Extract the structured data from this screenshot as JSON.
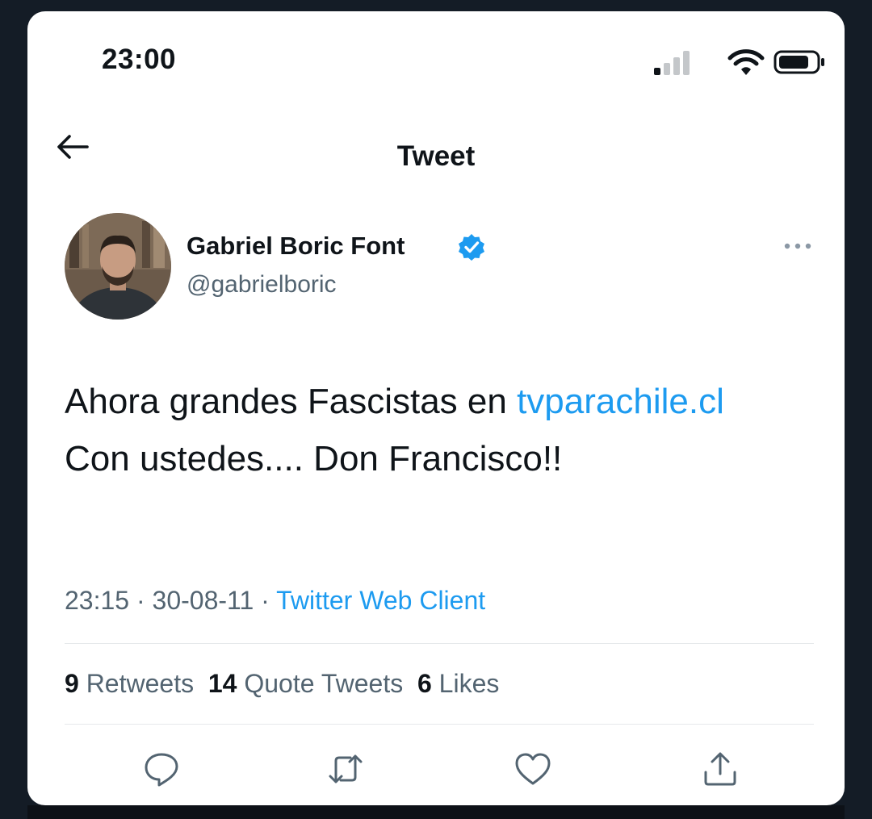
{
  "status_bar": {
    "time": "23:00",
    "signal_icon": "cellular-signal-icon",
    "wifi_icon": "wifi-icon",
    "battery_icon": "battery-icon"
  },
  "header": {
    "back_icon": "back-arrow-icon",
    "title": "Tweet"
  },
  "author": {
    "name": "Gabriel Boric Font",
    "handle": "@gabrielboric",
    "verified_icon": "verified-badge-icon",
    "more_icon": "more-options-icon"
  },
  "tweet": {
    "text_before": "Ahora grandes Fascistas en ",
    "link": "tvparachile.cl",
    "text_after": " Con ustedes.... Don Francisco!!",
    "time": "23:15",
    "sep1": " · ",
    "date": "30-08-11",
    "sep2": " · ",
    "source": "Twitter Web Client"
  },
  "stats": {
    "retweets_count": "9",
    "retweets_label": " Retweets",
    "quotes_count": "14",
    "quotes_label": " Quote Tweets",
    "likes_count": "6",
    "likes_label": " Likes"
  },
  "actions": [
    {
      "icon": "reply-icon"
    },
    {
      "icon": "retweet-icon"
    },
    {
      "icon": "like-icon"
    },
    {
      "icon": "share-icon"
    }
  ],
  "colors": {
    "accent": "#1d9bf0",
    "text": "#0f1419",
    "secondary": "#536471"
  }
}
